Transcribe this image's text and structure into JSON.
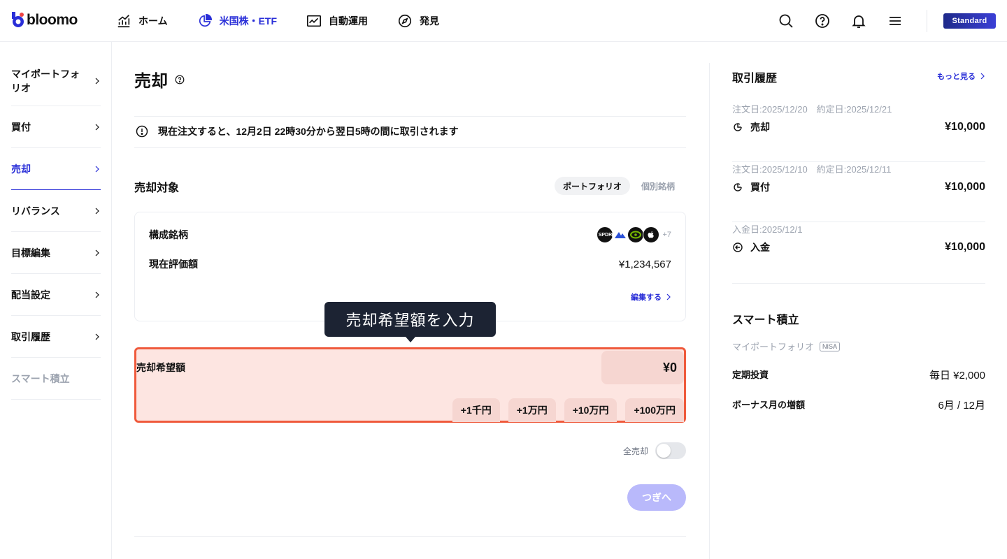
{
  "header": {
    "brand": "bloomo",
    "nav": [
      {
        "label": "ホーム",
        "icon": "chart-up-icon"
      },
      {
        "label": "米国株・ETF",
        "icon": "pie-chart-icon",
        "active": true
      },
      {
        "label": "自動運用",
        "icon": "trend-icon"
      },
      {
        "label": "発見",
        "icon": "compass-icon"
      }
    ],
    "plan": "Standard",
    "accent_color": "#2a2fd8"
  },
  "sidebar": {
    "items": [
      {
        "label": "マイポートフォリオ"
      },
      {
        "label": "買付"
      },
      {
        "label": "売却"
      },
      {
        "label": "リバランス"
      },
      {
        "label": "目標編集"
      },
      {
        "label": "配当設定"
      },
      {
        "label": "取引履歴"
      },
      {
        "label": "スマート積立"
      }
    ]
  },
  "main": {
    "title": "売却",
    "notice": "現在注文すると、12月2日 22時30分から翌日5時の間に取引されます",
    "section_title": "売却対象",
    "tabs": [
      "ポートフォリオ",
      "個別銘柄"
    ],
    "card": {
      "holdings_label": "構成銘柄",
      "logos": [
        "SPDR",
        "",
        "",
        ""
      ],
      "more_count": "+7",
      "valuation_label": "現在評価額",
      "valuation": "¥1,234,567",
      "edit": "編集する"
    },
    "tooltip": "売却希望額を入力",
    "amount": {
      "label": "売却希望額",
      "value": "¥0",
      "increments": [
        "+1千円",
        "+1万円",
        "+10万円",
        "+100万円"
      ]
    },
    "sell_all_label": "全売却",
    "next_label": "つぎへ"
  },
  "right": {
    "history_title": "取引履歴",
    "more": "もっと見る",
    "history": [
      {
        "dates": "注文日:2025/12/20　約定日:2025/12/21",
        "type": "売却",
        "amount": "¥10,000"
      },
      {
        "dates": "注文日:2025/12/10　約定日:2025/12/11",
        "type": "買付",
        "amount": "¥10,000"
      },
      {
        "dates": "入金日:2025/12/1",
        "type": "入金",
        "amount": "¥10,000"
      }
    ],
    "smart_title": "スマート積立",
    "smart_sub": "マイポートフォリオ",
    "nisa": "NISA",
    "rows": [
      {
        "label": "定期投資",
        "value": "毎日 ¥2,000"
      },
      {
        "label": "ボーナス月の増額",
        "value": "6月 / 12月"
      }
    ]
  }
}
